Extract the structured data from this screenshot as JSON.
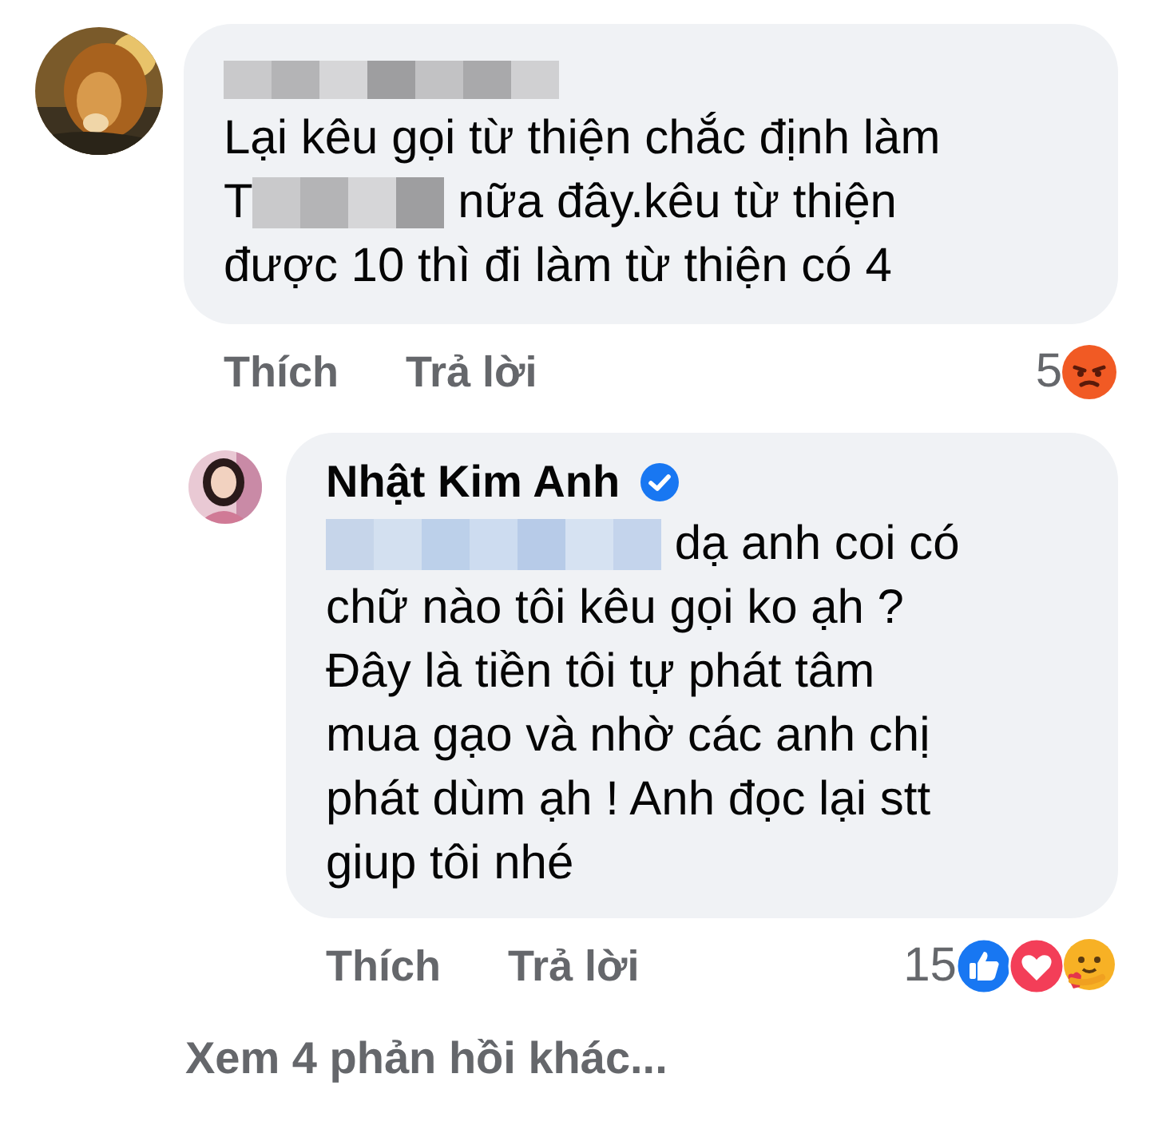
{
  "comments": [
    {
      "reply": false,
      "avatar": {
        "kind": "picture"
      },
      "name": [
        {
          "kind": "blur"
        }
      ],
      "verified": false,
      "lines": [
        [
          {
            "kind": "text",
            "text": "Lại kêu gọi từ thiện chắc định làm"
          }
        ],
        [
          {
            "kind": "text",
            "text": "T"
          },
          {
            "kind": "blur"
          },
          {
            "kind": "text",
            "text": " nữa đây.kêu từ thiện"
          }
        ],
        [
          {
            "kind": "text",
            "text": "được 10 thì đi làm từ thiện có 4"
          }
        ]
      ],
      "actions": [
        "Thích",
        "Trả lời"
      ],
      "reaction_count": "5",
      "reactions": [
        {
          "kind": "angry"
        }
      ]
    },
    {
      "reply": true,
      "avatar": {
        "kind": "picture"
      },
      "name": [
        {
          "kind": "text",
          "text": "Nhật Kim Anh"
        }
      ],
      "verified": true,
      "lines": [
        [
          {
            "kind": "mention-blur"
          },
          {
            "kind": "text",
            "text": " dạ anh coi có"
          }
        ],
        [
          {
            "kind": "text",
            "text": "chữ nào tôi kêu gọi ko ạh ?"
          }
        ],
        [
          {
            "kind": "text",
            "text": "Đây là tiền tôi tự phát tâm"
          }
        ],
        [
          {
            "kind": "text",
            "text": "mua gạo và nhờ các anh chị"
          }
        ],
        [
          {
            "kind": "text",
            "text": "phát dùm ạh ! Anh đọc lại stt"
          }
        ],
        [
          {
            "kind": "text",
            "text": "giup tôi nhé"
          }
        ]
      ],
      "actions": [
        "Thích",
        "Trả lời"
      ],
      "reaction_count": "15",
      "reactions": [
        {
          "kind": "like"
        },
        {
          "kind": "love"
        },
        {
          "kind": "care"
        }
      ]
    }
  ],
  "more_replies": "Xem 4 phản hồi khác..."
}
